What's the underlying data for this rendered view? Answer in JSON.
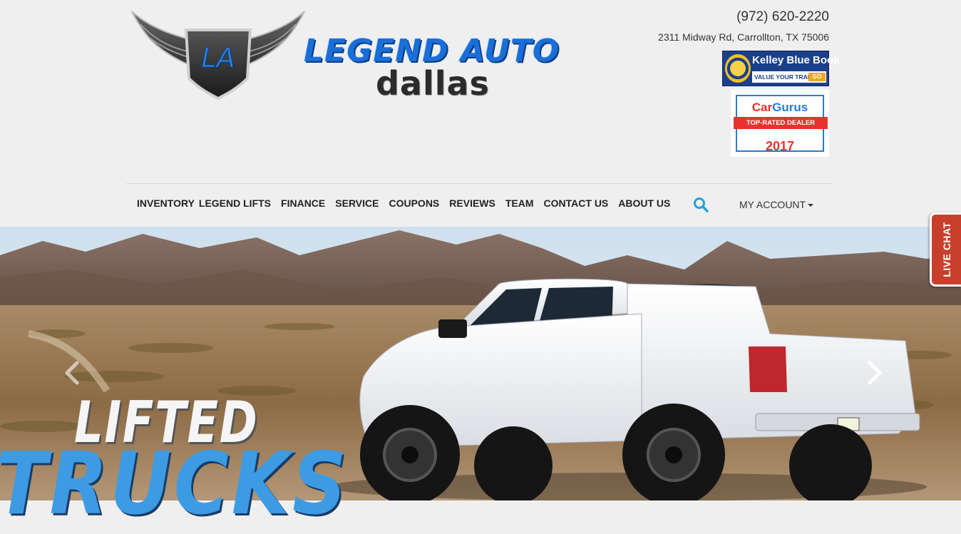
{
  "brand": {
    "monogram": "LA",
    "name_line1": "LEGEND AUTO",
    "name_line2": "dallas"
  },
  "contact": {
    "phone": "(972) 620-2220",
    "address": "2311 Midway Rd, Carrollton, TX 75006"
  },
  "badges": {
    "kbb_title": "Kelley Blue Book",
    "kbb_subtitle": "VALUE YOUR TRADE-IN",
    "kbb_go": "GO",
    "cargurus_logo_a": "Car",
    "cargurus_logo_b": "Gurus",
    "cargurus_ribbon": "TOP-RATED DEALER",
    "cargurus_year": "2017"
  },
  "nav": {
    "items": [
      {
        "label": "INVENTORY"
      },
      {
        "label": "LEGEND LIFTS"
      },
      {
        "label": "FINANCE"
      },
      {
        "label": "SERVICE"
      },
      {
        "label": "COUPONS"
      },
      {
        "label": "REVIEWS"
      },
      {
        "label": "TEAM"
      },
      {
        "label": "CONTACT US"
      },
      {
        "label": "ABOUT US"
      }
    ],
    "account_label": "MY ACCOUNT"
  },
  "hero": {
    "headline_line1": "LIFTED",
    "headline_line2": "TRUCKS"
  },
  "live_chat": {
    "label": "LIVE CHAT"
  },
  "colors": {
    "accent_blue": "#2a9fd6",
    "live_chat_red": "#c8402c",
    "headline_blue": "#3d9be3"
  }
}
